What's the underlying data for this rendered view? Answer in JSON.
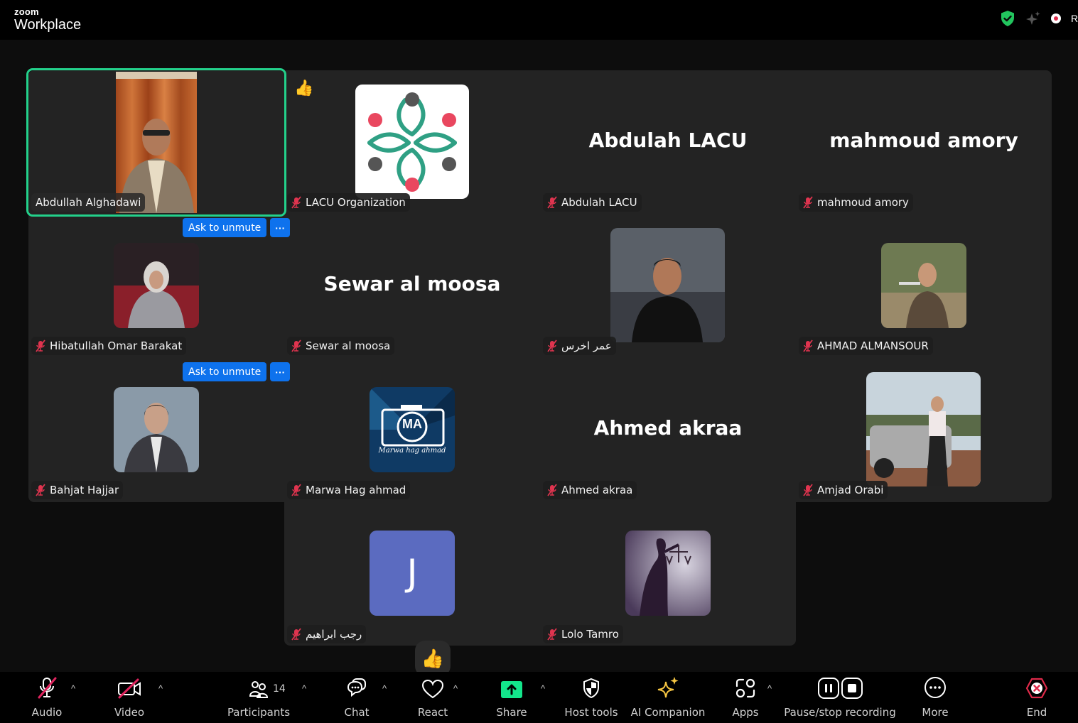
{
  "app": {
    "brand_small": "zoom",
    "brand_big": "Workplace",
    "recording_label": "R",
    "colors": {
      "active_speaker": "#23d18b",
      "button_blue": "#0e72ed",
      "muted_red": "#e0344f",
      "share_green": "#13e58b",
      "ai_gold": "#f5c542",
      "end_red": "#e02a4a"
    }
  },
  "header_icons": [
    "security-shield-icon",
    "ai-sparkle-icon",
    "recording-dot-icon"
  ],
  "participants": [
    {
      "name": "Abdullah Alghadawi",
      "display": "video",
      "muted": false,
      "active": true
    },
    {
      "name": "LACU Organization",
      "display": "logo",
      "muted": true,
      "reaction": "👍"
    },
    {
      "name": "Abdulah LACU",
      "display": "name",
      "muted": true
    },
    {
      "name": "mahmoud amory",
      "display": "name",
      "muted": true
    },
    {
      "name": "Hibatullah Omar Barakat",
      "display": "photo",
      "muted": true
    },
    {
      "name": "Sewar al moosa",
      "display": "name",
      "muted": true
    },
    {
      "name": "عمر اخرس",
      "display": "photo",
      "muted": true
    },
    {
      "name": "AHMAD ALMANSOUR",
      "display": "photo",
      "muted": true
    },
    {
      "name": "Bahjat Hajjar",
      "display": "photo",
      "muted": true
    },
    {
      "name": "Marwa Hag ahmad",
      "display": "photo",
      "muted": true,
      "photo_caption": "Marwa hag ahmad",
      "photo_initials": "MA"
    },
    {
      "name": "Ahmed akraa",
      "display": "name",
      "muted": true
    },
    {
      "name": "Amjad Orabi",
      "display": "photo",
      "muted": true
    },
    {
      "name": "رجب ابراهيم",
      "display": "initial",
      "initial": "J",
      "muted": true
    },
    {
      "name": "Lolo Tamro",
      "display": "photo",
      "muted": true
    }
  ],
  "tile_actions": {
    "ask_to_unmute": "Ask to unmute",
    "more": "···"
  },
  "toolbar": {
    "audio": "Audio",
    "video": "Video",
    "participants": "Participants",
    "participants_count": "14",
    "chat": "Chat",
    "react": "React",
    "share": "Share",
    "host_tools": "Host tools",
    "ai_companion": "AI Companion",
    "apps": "Apps",
    "recording": "Pause/stop recording",
    "more": "More",
    "end": "End",
    "floating_reaction": "👍"
  }
}
